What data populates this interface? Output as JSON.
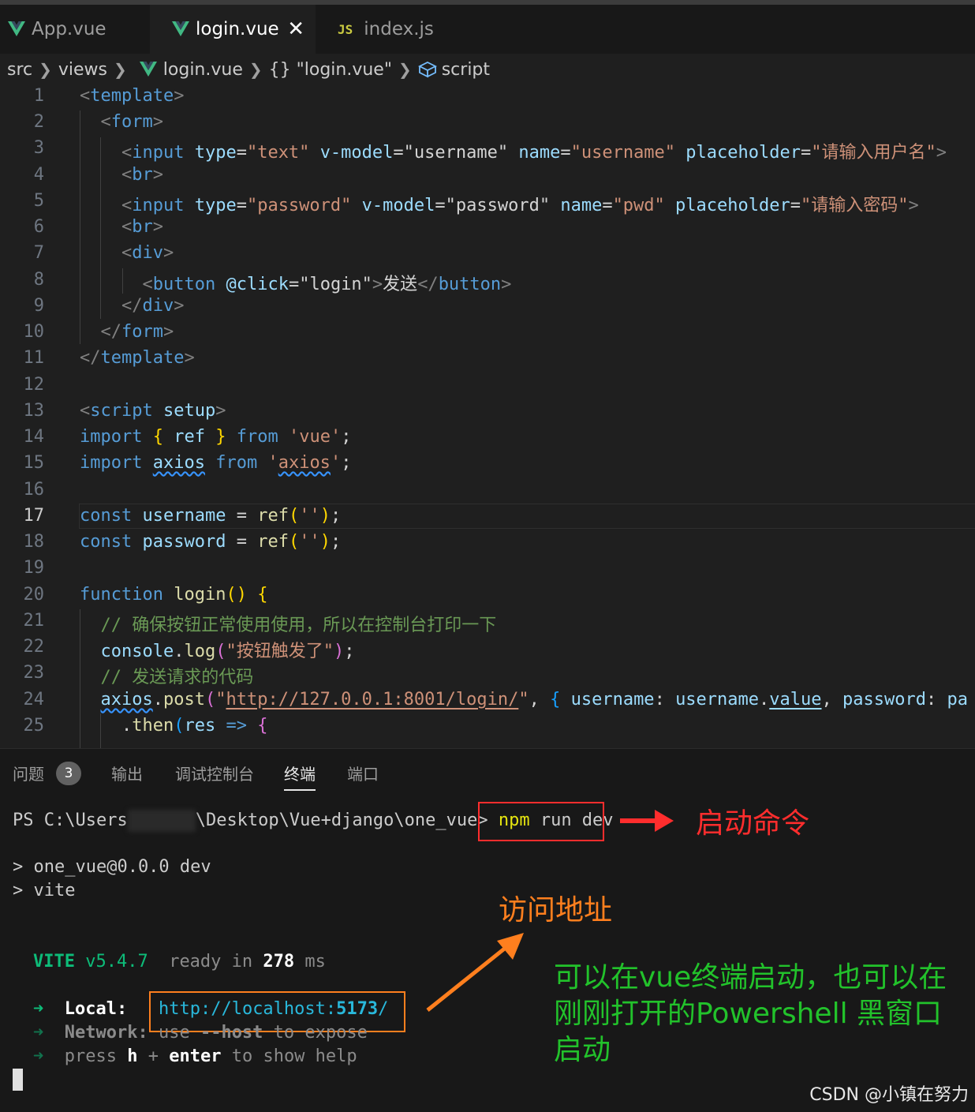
{
  "tabs": [
    {
      "label": "App.vue",
      "icon": "vue-icon"
    },
    {
      "label": "login.vue",
      "icon": "vue-icon",
      "active": true
    },
    {
      "label": "index.js",
      "icon": "js-icon"
    }
  ],
  "tab_js_badge": "JS",
  "breadcrumb": {
    "src": "src",
    "views": "views",
    "file": "login.vue",
    "obj": "{} \"login.vue\"",
    "script": "script"
  },
  "editor": {
    "current_line": "17",
    "line_numbers": [
      "1",
      "2",
      "3",
      "4",
      "5",
      "6",
      "7",
      "8",
      "9",
      "10",
      "11",
      "12",
      "13",
      "14",
      "15",
      "16",
      "17",
      "18",
      "19",
      "20",
      "21",
      "22",
      "23",
      "24",
      "25"
    ],
    "lines": {
      "l1": "template",
      "l2": "form",
      "l3_tag": "input",
      "l3_a1": "type",
      "l3_v1": "\"text\"",
      "l3_a2": "v-model",
      "l3_v2": "\"username\"",
      "l3_a3": "name",
      "l3_v3": "\"username\"",
      "l3_a4": "placeholder",
      "l3_v4": "\"请输入用户名\"",
      "l4": "br",
      "l5_tag": "input",
      "l5_a1": "type",
      "l5_v1": "\"password\"",
      "l5_a2": "v-model",
      "l5_v2": "\"password\"",
      "l5_a3": "name",
      "l5_v3": "\"pwd\"",
      "l5_a4": "placeholder",
      "l5_v4": "\"请输入密码\"",
      "l6": "br",
      "l7": "div",
      "l8_tag": "button",
      "l8_attr": "@click",
      "l8_val": "\"login\"",
      "l8_text": "发送",
      "l9": "div",
      "l10": "form",
      "l11": "template",
      "l13_tag": "script",
      "l13_attr": "setup",
      "l14_kw": "import",
      "l14_ref": "ref",
      "l14_from": "from",
      "l14_mod": "'vue'",
      "l15_kw": "import",
      "l15_axios": "axios",
      "l15_from": "from",
      "l15_mod_q1": "'",
      "l15_mod": "axios",
      "l15_mod_q2": "'",
      "l17_kw": "const",
      "l17_var": "username",
      "l17_fn": "ref",
      "l17_str": "''",
      "l18_kw": "const",
      "l18_var": "password",
      "l18_fn": "ref",
      "l18_str": "''",
      "l20_kw": "function",
      "l20_fn": "login",
      "l21": "// 确保按钮正常使用使用，所以在控制台打印一下",
      "l22_obj": "console",
      "l22_fn": "log",
      "l22_str": "\"按钮触发了\"",
      "l23": "// 发送请求的代码",
      "l24_obj": "axios",
      "l24_fn": "post",
      "l24_str_q": "\"",
      "l24_url": "http://127.0.0.1:8001/login/",
      "l24_k1": "username",
      "l24_v1a": "username",
      "l24_v1b": "value",
      "l24_k2": "password",
      "l24_trail": "pa",
      "l25_fn": "then",
      "l25_arg": "res"
    }
  },
  "panel": {
    "tabs": {
      "problems": "问题",
      "problems_count": "3",
      "output": "输出",
      "debug": "调试控制台",
      "terminal": "终端",
      "ports": "端口"
    },
    "terminal": {
      "prompt_a": "PS C:\\Users",
      "prompt_b": "\\Desktop\\Vue+django\\one_vue>",
      "cmd_npm": "npm",
      "cmd_rest": " run dev",
      "out1": "> one_vue@0.0.0 dev",
      "out2": "> vite",
      "vite": "VITE",
      "vite_ver": " v5.4.7",
      "ready": "  ready in ",
      "ready_ms": "278",
      "ms": " ms",
      "arrow": "➜",
      "local_label": "Local:",
      "local_url_a": "http://localhost:",
      "local_url_port": "5173",
      "local_url_b": "/",
      "network_label": "Network:",
      "network_a": " use ",
      "network_b": "--host",
      "network_c": " to expose",
      "press_a": "press ",
      "press_h": "h",
      "press_plus": " + ",
      "press_enter": "enter",
      "press_b": " to show help"
    }
  },
  "annotations": {
    "start_cmd": "启动命令",
    "visit": "访问地址",
    "note_l1": "可以在vue终端启动，也可以在",
    "note_l2": "刚刚打开的Powershell 黑窗口",
    "note_l3": "启动"
  },
  "watermark": "CSDN @小镇在努力",
  "colors": {
    "red": "#ff2d2d",
    "orange": "#ff7f1e",
    "green": "#22c22b",
    "vue": "#41b883"
  }
}
